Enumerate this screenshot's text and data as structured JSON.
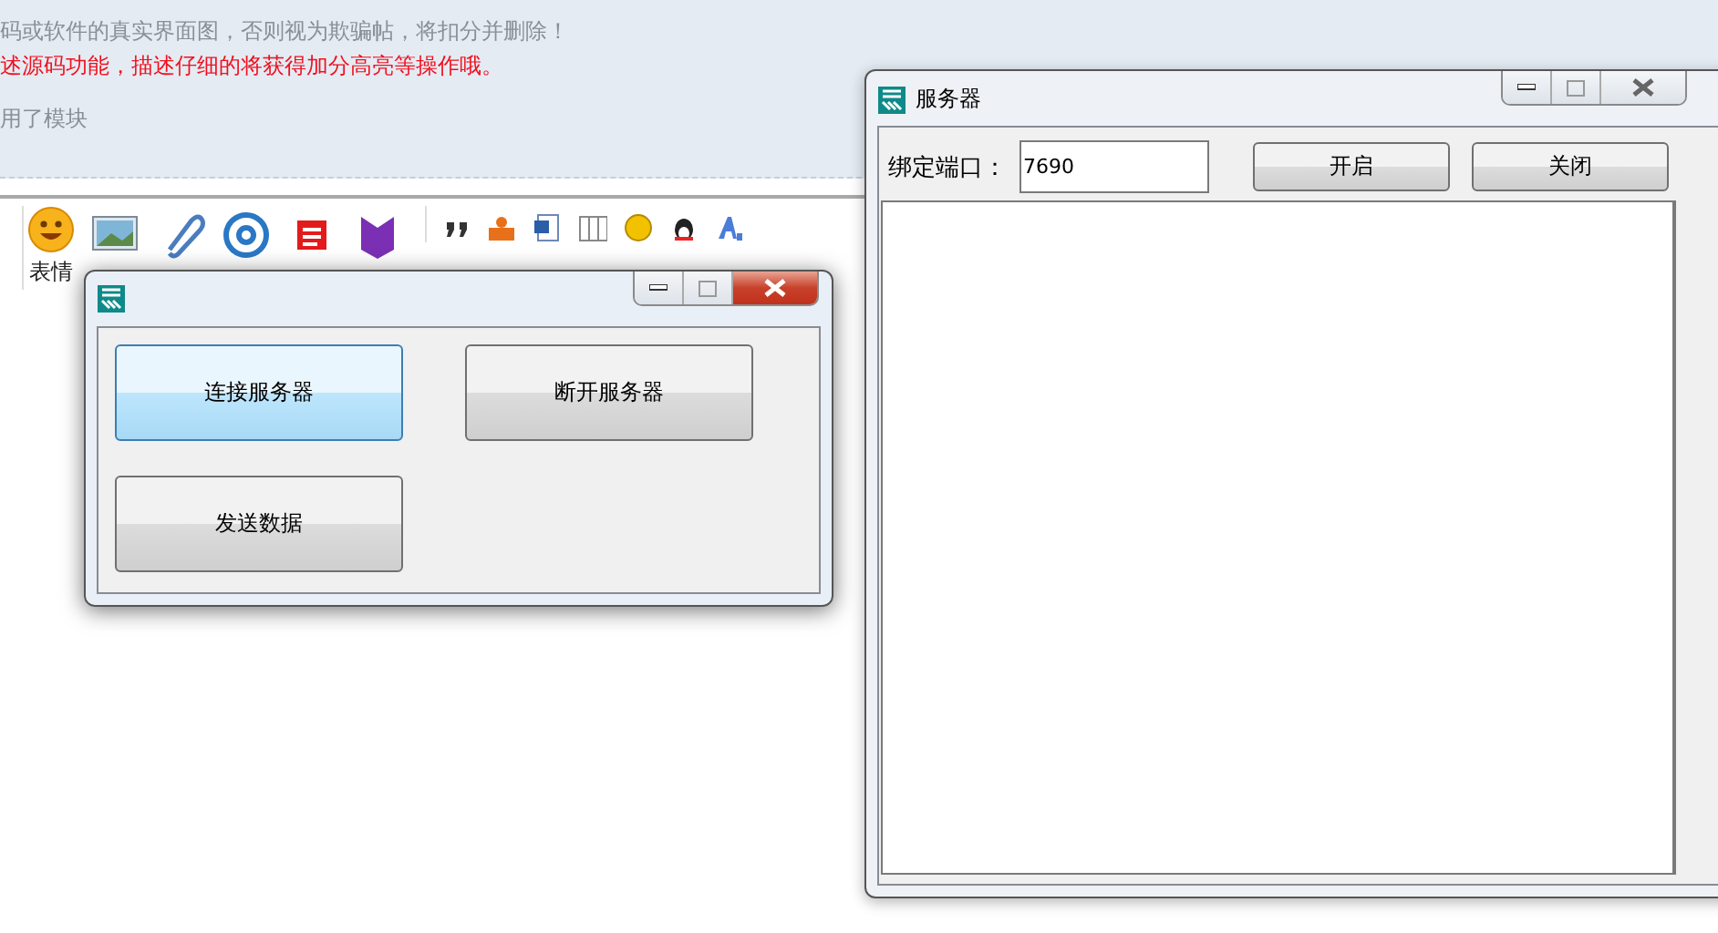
{
  "page": {
    "notices": [
      {
        "text": "码或软件的真实界面图，否则视为欺骗帖，将扣分并删除！",
        "kind": "note"
      },
      {
        "text": "述源码功能，描述仔细的将获得加分高亮等操作哦。",
        "kind": "warning"
      },
      {
        "text": "用了模块",
        "kind": "note"
      }
    ],
    "toolbar": {
      "label": "表情"
    }
  },
  "windows": [
    {
      "kind": "client",
      "active": true,
      "buttons": [
        {
          "label": "连接服务器",
          "hovered": true
        },
        {
          "label": "断开服务器",
          "hovered": false
        },
        {
          "label": "发送数据",
          "hovered": false
        }
      ]
    },
    {
      "kind": "server",
      "active": false,
      "title": "服务器",
      "port_label": "绑定端口：",
      "port_value": "7690",
      "buttons": [
        {
          "label": "开启",
          "hovered": false
        },
        {
          "label": "关闭",
          "hovered": false
        }
      ]
    }
  ]
}
